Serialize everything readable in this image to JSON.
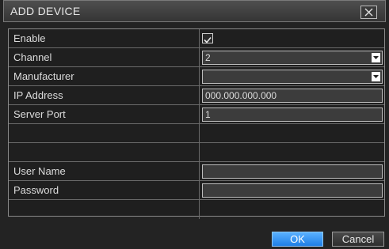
{
  "dialog": {
    "title": "ADD DEVICE",
    "close_glyph": "close-icon"
  },
  "form": {
    "enable": {
      "label": "Enable",
      "checked": true
    },
    "channel": {
      "label": "Channel",
      "value": "2"
    },
    "manufacturer": {
      "label": "Manufacturer",
      "value": ""
    },
    "ip_address": {
      "label": "IP Address",
      "value": "000.000.000.000"
    },
    "server_port": {
      "label": "Server Port",
      "value": "1"
    },
    "user_name": {
      "label": "User Name",
      "value": ""
    },
    "password": {
      "label": "Password",
      "value": ""
    }
  },
  "buttons": {
    "ok": "OK",
    "cancel": "Cancel"
  },
  "colors": {
    "accent": "#1f7fe6",
    "background": "#232323"
  }
}
